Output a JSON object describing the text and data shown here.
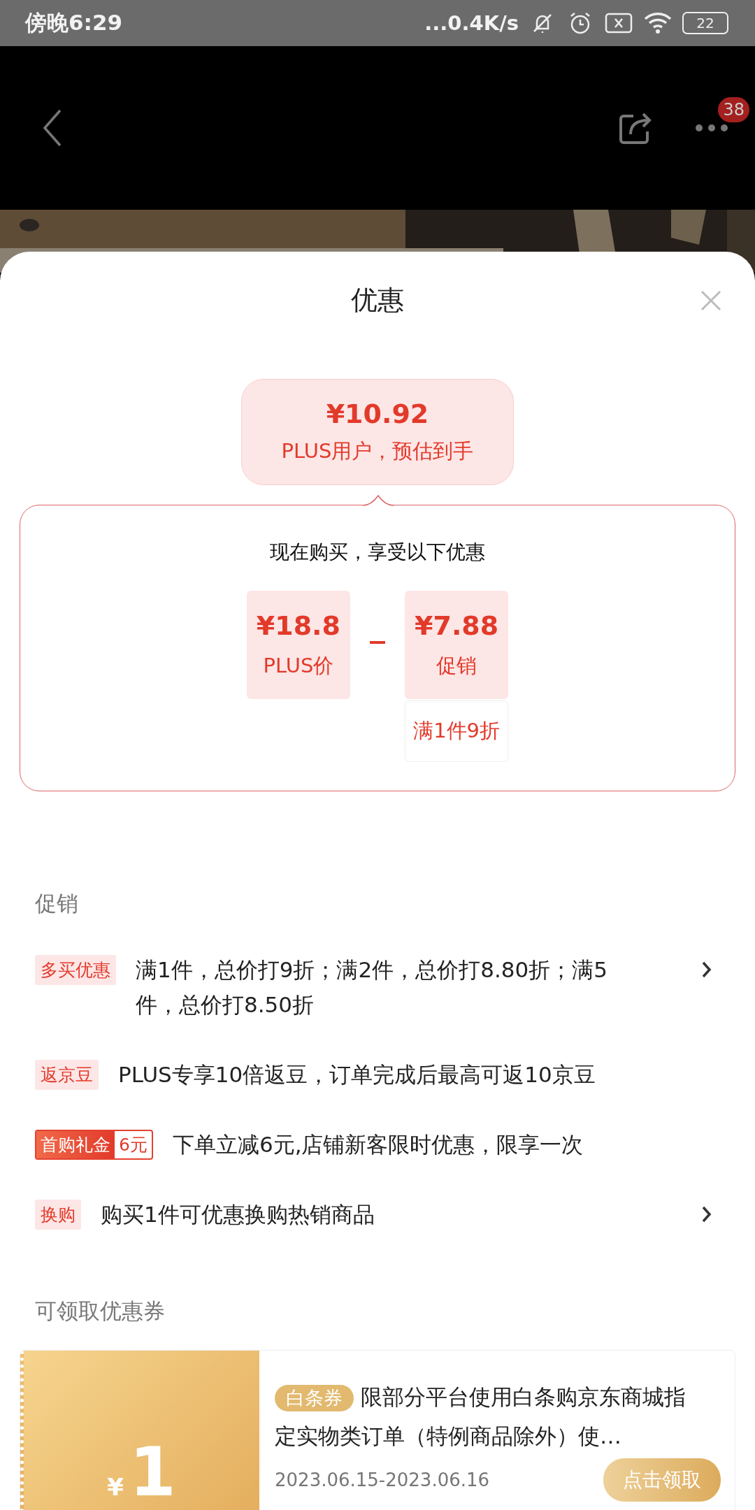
{
  "status_bar": {
    "time": "傍晚6:29",
    "network_speed": "...0.4K/s",
    "battery": "22"
  },
  "header": {
    "badge": "38"
  },
  "sheet": {
    "title": "优惠"
  },
  "estimate": {
    "price": "¥10.92",
    "note": "PLUS用户，预估到手"
  },
  "breakdown": {
    "heading": "现在购买，享受以下优惠",
    "items": [
      {
        "price": "¥18.8",
        "label": "PLUS价"
      },
      {
        "price": "¥7.88",
        "label": "促销",
        "condition": "满1件9折"
      }
    ]
  },
  "promotions": {
    "title": "促销",
    "items": [
      {
        "kind": "plain",
        "tag": "多买优惠",
        "text": "满1件，总价打9折；满2件，总价打8.80折；满5件，总价打8.50折",
        "expandable": true
      },
      {
        "kind": "plain",
        "tag": "返京豆",
        "text": "PLUS专享10倍返豆，订单完成后最高可返10京豆",
        "expandable": false
      },
      {
        "kind": "gift",
        "tag": "首购礼金",
        "amount": "6元",
        "text": "下单立减6元,店铺新客限时优惠，限享一次",
        "expandable": false
      },
      {
        "kind": "plain",
        "tag": "换购",
        "text": "购买1件可优惠换购热销商品",
        "expandable": true
      }
    ]
  },
  "coupons": {
    "title": "可领取优惠券",
    "items": [
      {
        "currency": "¥",
        "amount": "1",
        "badge": "白条券",
        "description": "限部分平台使用白条购京东商城指定实物类订单（特例商品除外）使…",
        "validity": "2023.06.15-2023.06.16",
        "button": "点击领取"
      }
    ]
  }
}
